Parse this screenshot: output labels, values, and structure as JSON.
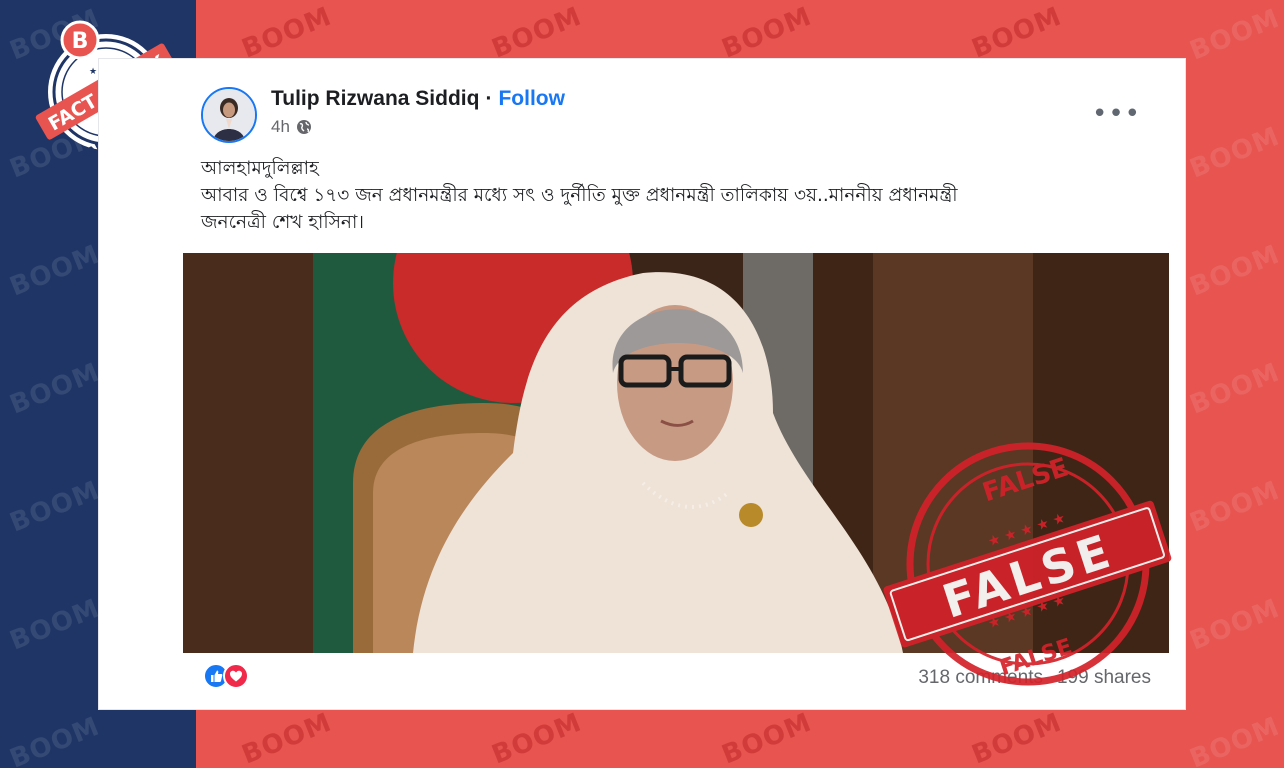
{
  "badge": {
    "letter": "B",
    "text": "FACT CHECK",
    "sub": "BANGLADESH"
  },
  "watermark": "BOOM",
  "post": {
    "author": "Tulip Rizwana Siddiq",
    "separator": "·",
    "follow_label": "Follow",
    "time": "4h",
    "more_label": "•••",
    "text_line1": "আলহামদুলিল্লাহ",
    "text_line2": "আবার ও বিশ্বে ১৭৩ জন প্রধানমন্ত্রীর মধ্যে সৎ ও দুর্নীতি মুক্ত প্রধানমন্ত্রী তালিকায়  ৩য়..মাননীয় প্রধানমন্ত্রী",
    "text_line3": "জননেত্রী শেখ হাসিনা।",
    "comments": "318 comments",
    "shares": "199 shares"
  },
  "stamp": {
    "text": "FALSE"
  },
  "colors": {
    "navy": "#1f3566",
    "brand_red": "#e85450",
    "fb_blue": "#1877f2",
    "stamp_red": "#d3222a"
  }
}
